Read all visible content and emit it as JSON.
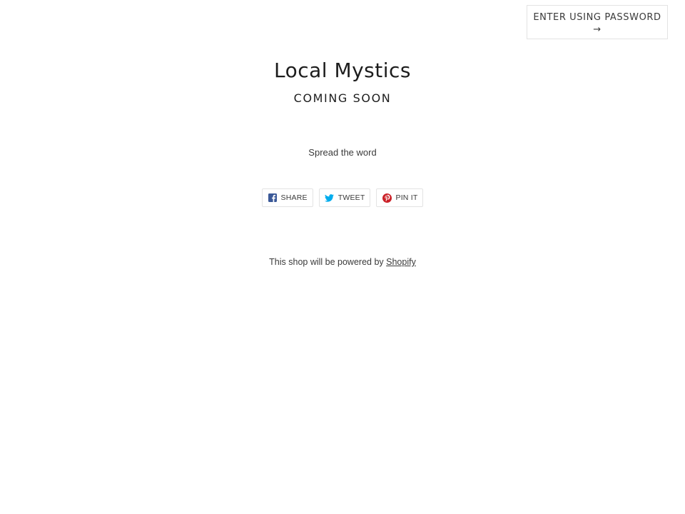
{
  "password_button": {
    "label": "ENTER USING PASSWORD",
    "arrow": "→"
  },
  "header": {
    "shop_name": "Local Mystics",
    "tagline": "COMING SOON"
  },
  "share": {
    "heading": "Spread the word",
    "buttons": [
      {
        "label": "SHARE",
        "icon": "facebook-icon",
        "color": "#3b5998"
      },
      {
        "label": "TWEET",
        "icon": "twitter-icon",
        "color": "#00aced"
      },
      {
        "label": "PIN IT",
        "icon": "pinterest-icon",
        "color": "#cb2027"
      }
    ]
  },
  "footer": {
    "powered_text": "This shop will be powered by",
    "link_text": "Shopify"
  }
}
